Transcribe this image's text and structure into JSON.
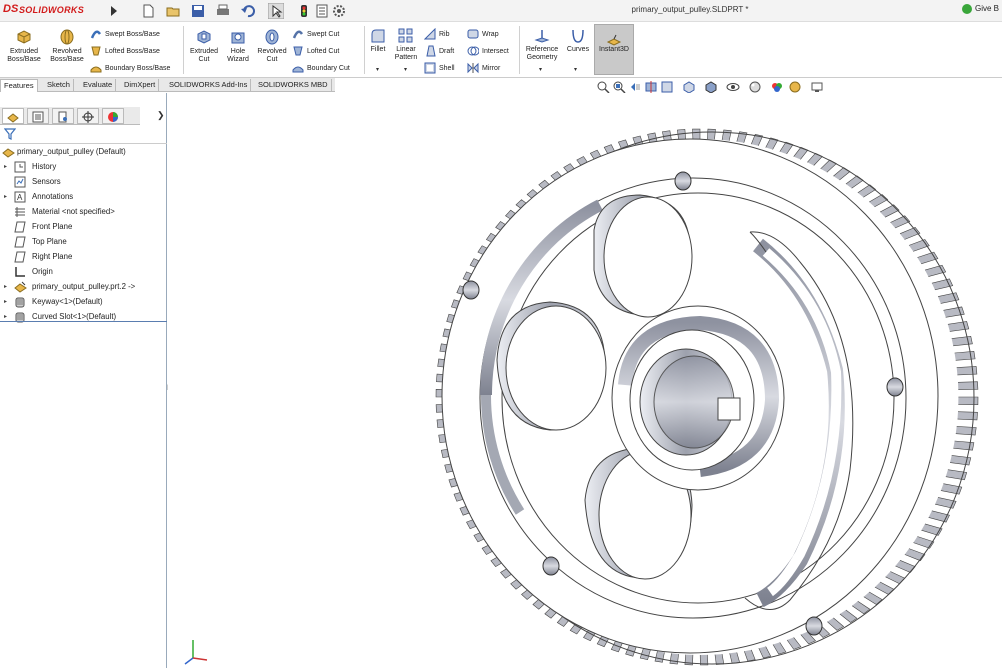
{
  "app": {
    "brand": "SOLIDWORKS",
    "brand_prefix": "DS"
  },
  "window": {
    "title": "primary_output_pulley.SLDPRT *",
    "give_feedback": "Give B"
  },
  "ribbon": {
    "extruded_boss": "Extruded Boss/Base",
    "revolved_boss": "Revolved Boss/Base",
    "swept_boss": "Swept Boss/Base",
    "lofted_boss": "Lofted Boss/Base",
    "boundary_boss": "Boundary Boss/Base",
    "extruded_cut": "Extruded Cut",
    "hole_wizard": "Hole Wizard",
    "revolved_cut": "Revolved Cut",
    "swept_cut": "Swept Cut",
    "lofted_cut": "Lofted Cut",
    "boundary_cut": "Boundary Cut",
    "fillet": "Fillet",
    "linear_pattern": "Linear Pattern",
    "rib": "Rib",
    "draft": "Draft",
    "shell": "Shell",
    "wrap": "Wrap",
    "intersect": "Intersect",
    "mirror": "Mirror",
    "reference_geometry": "Reference Geometry",
    "curves": "Curves",
    "instant3d": "Instant3D"
  },
  "command_tabs": [
    "Features",
    "Sketch",
    "Evaluate",
    "DimXpert",
    "SOLIDWORKS Add-Ins",
    "SOLIDWORKS MBD"
  ],
  "active_tab": "Features",
  "feature_tree": {
    "root": "primary_output_pulley  (Default)",
    "items": [
      {
        "label": "History",
        "icon": "history-icon",
        "expandable": true
      },
      {
        "label": "Sensors",
        "icon": "sensors-icon",
        "expandable": false
      },
      {
        "label": "Annotations",
        "icon": "annotations-icon",
        "expandable": true
      },
      {
        "label": "Material <not specified>",
        "icon": "material-icon",
        "expandable": false
      },
      {
        "label": "Front Plane",
        "icon": "plane-icon",
        "expandable": false
      },
      {
        "label": "Top Plane",
        "icon": "plane-icon",
        "expandable": false
      },
      {
        "label": "Right Plane",
        "icon": "plane-icon",
        "expandable": false
      },
      {
        "label": "Origin",
        "icon": "origin-icon",
        "expandable": false
      },
      {
        "label": "primary_output_pulley.prt.2 ->",
        "icon": "part-icon",
        "expandable": true
      },
      {
        "label": "Keyway<1>(Default)",
        "icon": "feature-icon",
        "expandable": true
      },
      {
        "label": "Curved Slot<1>(Default)",
        "icon": "feature-icon",
        "expandable": true
      }
    ]
  },
  "colors": {
    "brand_red": "#d21a1a",
    "selection_blue": "#5a7db0",
    "metal": "#b8bac3"
  }
}
